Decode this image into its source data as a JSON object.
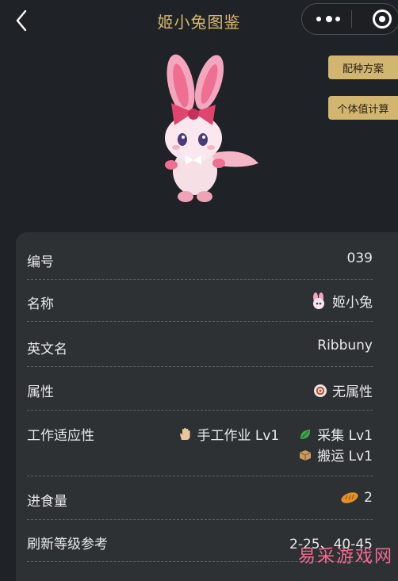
{
  "header": {
    "title": "姬小兔图鉴"
  },
  "side_buttons": {
    "breeding": "配种方案",
    "iv_calc": "个体值计算"
  },
  "details": {
    "number_label": "编号",
    "number_value": "039",
    "name_label": "名称",
    "name_value": "姬小兔",
    "english_label": "英文名",
    "english_value": "Ribbuny",
    "element_label": "属性",
    "element_value": "无属性",
    "work_label": "工作适应性",
    "work": [
      {
        "icon": "hand-icon",
        "text": "手工作业 Lv1"
      },
      {
        "icon": "leaf-icon",
        "text": "采集 Lv1"
      },
      {
        "icon": "box-icon",
        "text": "搬运 Lv1"
      }
    ],
    "food_label": "进食量",
    "food_value": "2",
    "refresh_label": "刷新等级参考",
    "refresh_value": "2-25、40-45"
  },
  "watermark": "易采游戏网",
  "colors": {
    "accent": "#d8b66c",
    "button_bg": "#d2b56e",
    "card_bg": "#2e3134",
    "page_bg": "#1f2226"
  }
}
